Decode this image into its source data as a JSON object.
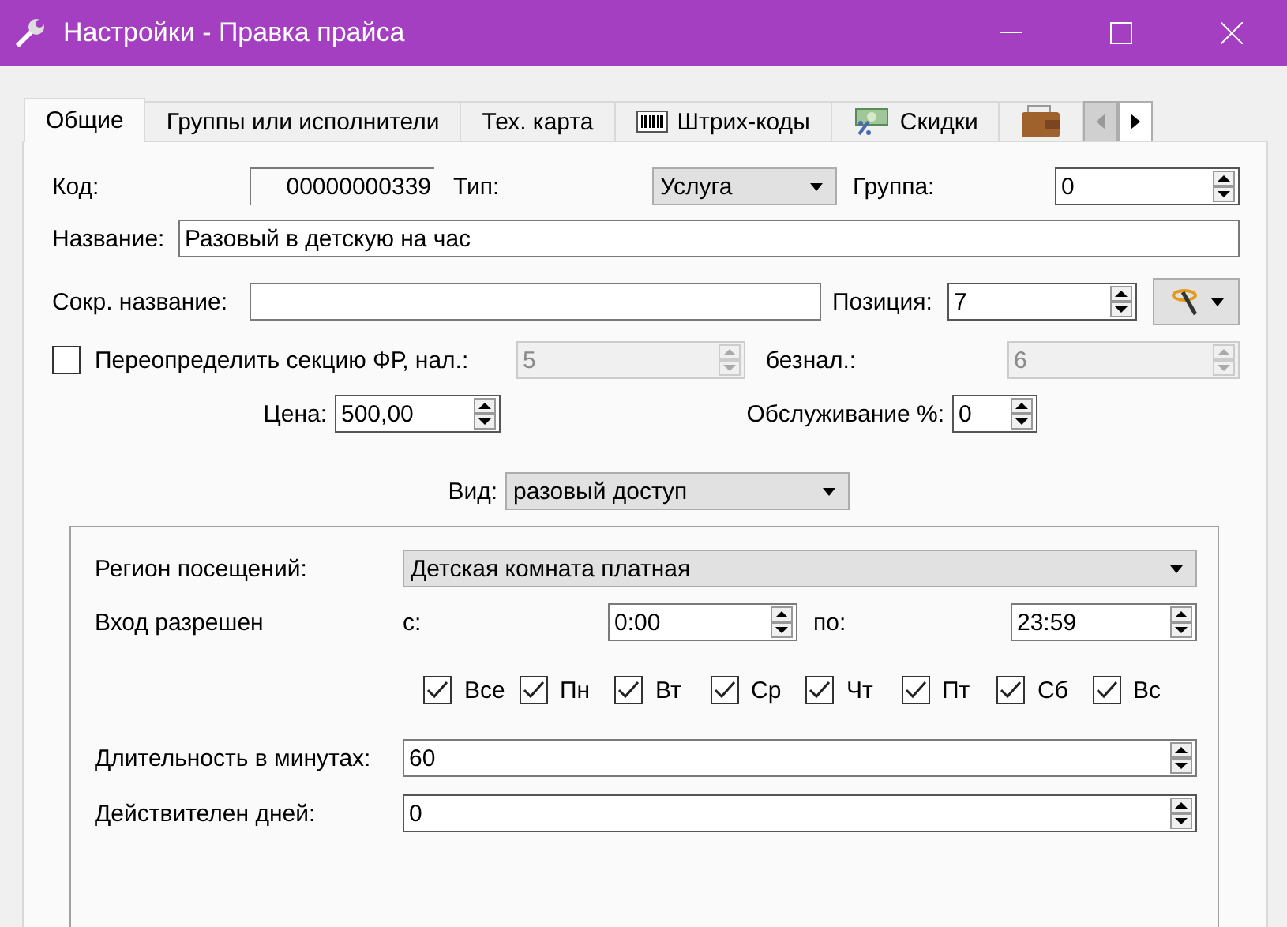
{
  "window": {
    "title": "Настройки - Правка прайса"
  },
  "tabs": [
    {
      "kind": "text",
      "label": "Общие",
      "selected": true
    },
    {
      "kind": "text",
      "label": "Группы или исполнители",
      "selected": false
    },
    {
      "kind": "text",
      "label": "Тех. карта",
      "selected": false
    },
    {
      "kind": "icon",
      "label": "Штрих-коды",
      "selected": false
    },
    {
      "kind": "icon",
      "label": "Скидки",
      "selected": false
    },
    {
      "kind": "icon",
      "selected": false
    }
  ],
  "form": {
    "code": {
      "label": "Код:",
      "value": "00000000339"
    },
    "type": {
      "label": "Тип:",
      "value": "Услуга"
    },
    "group": {
      "label": "Группа:",
      "value": "0",
      "disabled": false
    },
    "name": {
      "label": "Название:",
      "value": "Разовый в детскую на час"
    },
    "short_name": {
      "label": "Сокр. название:"
    },
    "position": {
      "label": "Позиция:",
      "value": "7",
      "disabled": false
    },
    "override": {
      "label": "Переопределить секцию ФР, нал.:",
      "checked": false
    },
    "cash_section": {
      "value": "5",
      "disabled": true
    },
    "cashless": {
      "label": "безнал.:",
      "value": "6",
      "disabled": true
    },
    "price": {
      "label": "Цена:",
      "value": "500,00",
      "disabled": false
    },
    "service": {
      "label": "Обслуживание %:",
      "value": "0",
      "disabled": false
    },
    "kind": {
      "label": "Вид:",
      "value": "разовый доступ"
    }
  },
  "access": {
    "region": {
      "label": "Регион посещений:",
      "value": "Детская комната платная"
    },
    "entry": {
      "label": "Вход разрешен",
      "from_label": "с:",
      "from": {
        "value": "0:00",
        "disabled": false
      },
      "to_label": "по:",
      "to": {
        "value": "23:59",
        "disabled": false
      }
    },
    "days": [
      {
        "label": "Все",
        "checked": true
      },
      {
        "label": "Пн",
        "checked": true
      },
      {
        "label": "Вт",
        "checked": true
      },
      {
        "label": "Ср",
        "checked": true
      },
      {
        "label": "Чт",
        "checked": true
      },
      {
        "label": "Пт",
        "checked": true
      },
      {
        "label": "Сб",
        "checked": true
      },
      {
        "label": "Вс",
        "checked": true
      }
    ],
    "duration": {
      "label": "Длительность в минутах:",
      "value": "60",
      "disabled": false
    },
    "valid_days": {
      "label": "Действителен дней:",
      "value": "0",
      "disabled": false
    }
  }
}
